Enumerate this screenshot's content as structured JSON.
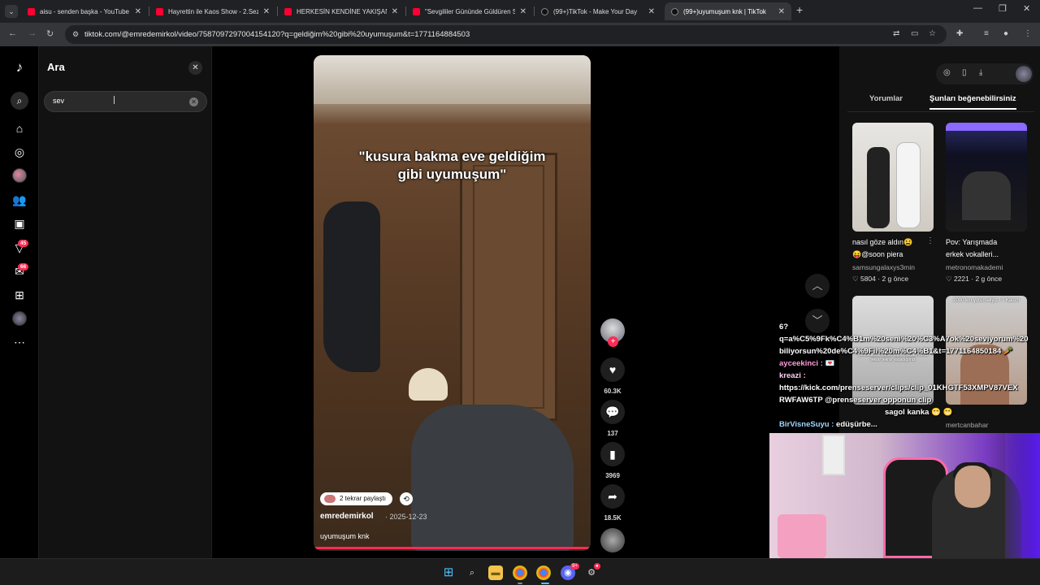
{
  "browser": {
    "tabs": [
      {
        "label": "aisu - senden başka - YouTube",
        "favicon": "youtube-icon",
        "active": false
      },
      {
        "label": "Hayrettin ile Kaos Show - 2.Sez",
        "favicon": "youtube-icon",
        "active": false
      },
      {
        "label": "HERKESİN KENDİNE YAKIŞANI",
        "favicon": "youtube-icon",
        "active": false
      },
      {
        "label": "\"Sevgililer Gününde Güldüren S",
        "favicon": "youtube-icon",
        "active": false
      },
      {
        "label": "(99+)TikTok - Make Your Day",
        "favicon": "tiktok-icon",
        "active": false
      },
      {
        "label": "(99+)uyumuşum knk | TikTok",
        "favicon": "tiktok-icon",
        "active": true
      }
    ],
    "url": "tiktok.com/@emredemirkol/video/7587097297004154120?q=geldiğim%20gibi%20uyumuşum&t=1771164884503"
  },
  "search_panel": {
    "title": "Ara",
    "query": "sev",
    "close_glyph": "✕",
    "clear_glyph": "✕"
  },
  "left_nav": {
    "badges": {
      "activity": "45",
      "messages": "66"
    }
  },
  "video": {
    "caption_line1": "\"kusura bakma eve geldiğim",
    "caption_line2": "gibi uyumuşum\"",
    "repost_label": "2 tekrar paylaştı",
    "author": "emredemirkol",
    "date": "· 2025-12-23",
    "description": "uyumuşum knk",
    "progress": 1.0,
    "likes": "60.3K",
    "comments": "137",
    "saves": "3969",
    "shares": "18.5K"
  },
  "right_panel": {
    "tabs": [
      {
        "label": "Yorumlar",
        "active": false
      },
      {
        "label": "Şunları beğenebilirsiniz",
        "active": true
      }
    ],
    "cards": [
      {
        "title1": "nasıl göze aldın😫",
        "title2": "😝@soon piera",
        "user": "samsungalaxys3min",
        "likes": "♡ 5804",
        "age": "· 2 g önce"
      },
      {
        "title1": "Pov: Yarışmada",
        "title2": "erkek vokalleri...",
        "user": "metronomakademi",
        "likes": "♡ 2221",
        "age": "· 2 g önce"
      },
      {
        "title1": "",
        "title2": "",
        "user": "",
        "likes": "",
        "age": "",
        "overlay": "şulsukaldaki kantin tüpler, hayatımızda tekrar tekrar yaşadığımız"
      },
      {
        "title1": "",
        "title2": "",
        "user": "mertcanbahar",
        "likes": "",
        "age": "",
        "overlay": "2000 km yürümeliyiz / 7 Kasım"
      }
    ]
  },
  "stream_overlay": {
    "chat_lines": [
      {
        "user": "",
        "text": "6?"
      },
      {
        "user": "",
        "text": "q=a%C5%9Fk%C4%B1m%20seni%20%C3%A7ok%20seviyorum%20"
      },
      {
        "user": "",
        "text": "biliyorsun%20de%C4%9Fil%20m%C4%B1&t=1771164850184 🥕"
      },
      {
        "user": "ayceekinci :",
        "text": "💌"
      },
      {
        "user": "kreazi :",
        "text": ""
      },
      {
        "user": "",
        "text": "https://kick.com/prenseserver/clips/clip_01KHGTF53XMPV87VEX"
      },
      {
        "user": "",
        "text": "RWFAW6TP @prenseserver opponun clip"
      },
      {
        "user": "",
        "text": "sagol kanka 😁 😁"
      },
      {
        "user": "BirVisneSuyu :",
        "text": "edüşürbe..."
      }
    ]
  },
  "colors": {
    "accent": "#fe2c55",
    "tab_bg": "#202124",
    "toolbar_bg": "#35363a",
    "panel_bg": "#121212"
  }
}
